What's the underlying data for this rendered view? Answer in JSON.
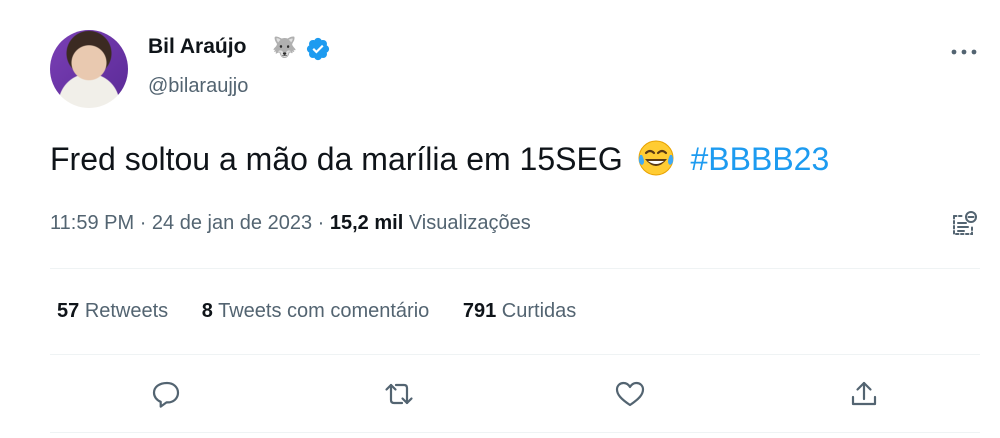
{
  "author": {
    "name": "Bil Araújo",
    "name_emoji": "🐺",
    "handle": "@bilaraujjo",
    "verified": true
  },
  "tweet": {
    "text": "Fred soltou a mão da marília em 15SEG",
    "emoji": "laughing-tears-emoji",
    "hashtag": "#BBBB23"
  },
  "meta": {
    "time": "11:59 PM",
    "sep1": "·",
    "date": "24 de jan de 2023",
    "sep2": "·",
    "views_count": "15,2 mil",
    "views_label": "Visualizações"
  },
  "stats": {
    "retweets_count": "57",
    "retweets_label": "Retweets",
    "quotes_count": "8",
    "quotes_label": "Tweets com comentário",
    "likes_count": "791",
    "likes_label": "Curtidas"
  },
  "icons": {
    "more": "more-horizontal-icon",
    "analytics": "analytics-icon",
    "reply": "reply-icon",
    "retweet": "retweet-icon",
    "like": "heart-icon",
    "share": "share-icon"
  },
  "colors": {
    "accent": "#1d9bf0",
    "text": "#0f1419",
    "secondary": "#536471",
    "divider": "#eff3f4",
    "avatar_bg": "#6a35a8"
  }
}
